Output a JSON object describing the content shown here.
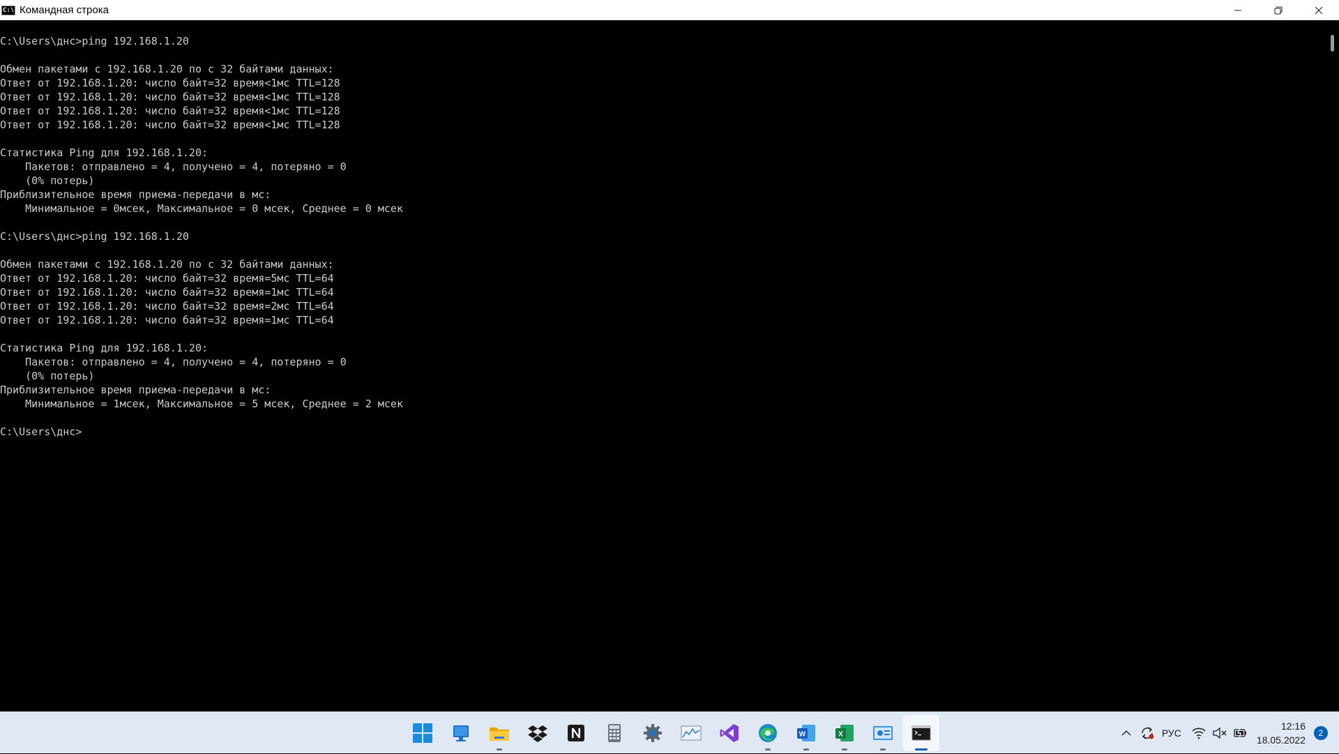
{
  "window": {
    "title": "Командная строка",
    "icon_label": "C:\\"
  },
  "console": {
    "lines": [
      "C:\\Users\\днс>ping 192.168.1.20",
      "",
      "Обмен пакетами с 192.168.1.20 по с 32 байтами данных:",
      "Ответ от 192.168.1.20: число байт=32 время<1мс TTL=128",
      "Ответ от 192.168.1.20: число байт=32 время<1мс TTL=128",
      "Ответ от 192.168.1.20: число байт=32 время<1мс TTL=128",
      "Ответ от 192.168.1.20: число байт=32 время<1мс TTL=128",
      "",
      "Статистика Ping для 192.168.1.20:",
      "    Пакетов: отправлено = 4, получено = 4, потеряно = 0",
      "    (0% потерь)",
      "Приблизительное время приема-передачи в мс:",
      "    Минимальное = 0мсек, Максимальное = 0 мсек, Среднее = 0 мсек",
      "",
      "C:\\Users\\днс>ping 192.168.1.20",
      "",
      "Обмен пакетами с 192.168.1.20 по с 32 байтами данных:",
      "Ответ от 192.168.1.20: число байт=32 время=5мс TTL=64",
      "Ответ от 192.168.1.20: число байт=32 время=1мс TTL=64",
      "Ответ от 192.168.1.20: число байт=32 время=2мс TTL=64",
      "Ответ от 192.168.1.20: число байт=32 время=1мс TTL=64",
      "",
      "Статистика Ping для 192.168.1.20:",
      "    Пакетов: отправлено = 4, получено = 4, потеряно = 0",
      "    (0% потерь)",
      "Приблизительное время приема-передачи в мс:",
      "    Минимальное = 1мсек, Максимальное = 5 мсек, Среднее = 2 мсек",
      "",
      "C:\\Users\\днс>"
    ]
  },
  "taskbar": {
    "apps": [
      {
        "name": "start-button",
        "icon": "windows-logo-icon",
        "running": false,
        "active": false
      },
      {
        "name": "taskbar-app-desktop",
        "icon": "desktop-icon",
        "running": false,
        "active": false
      },
      {
        "name": "taskbar-app-file-explorer",
        "icon": "folder-icon",
        "running": true,
        "active": false
      },
      {
        "name": "taskbar-app-dropbox",
        "icon": "dropbox-icon",
        "running": false,
        "active": false
      },
      {
        "name": "taskbar-app-notion",
        "icon": "notion-icon",
        "running": false,
        "active": false
      },
      {
        "name": "taskbar-app-calculator",
        "icon": "calculator-icon",
        "running": false,
        "active": false
      },
      {
        "name": "taskbar-app-settings",
        "icon": "gear-icon",
        "running": false,
        "active": false
      },
      {
        "name": "taskbar-app-monitor",
        "icon": "chart-icon",
        "running": false,
        "active": false
      },
      {
        "name": "taskbar-app-visual-studio",
        "icon": "visual-studio-icon",
        "running": false,
        "active": false
      },
      {
        "name": "taskbar-app-edge",
        "icon": "edge-icon",
        "running": true,
        "active": false
      },
      {
        "name": "taskbar-app-word",
        "icon": "word-icon",
        "running": true,
        "active": false
      },
      {
        "name": "taskbar-app-excel",
        "icon": "excel-icon",
        "running": true,
        "active": false
      },
      {
        "name": "taskbar-app-control-panel",
        "icon": "control-panel-icon",
        "running": true,
        "active": false
      },
      {
        "name": "taskbar-app-command-prompt",
        "icon": "terminal-icon",
        "running": true,
        "active": true
      }
    ],
    "tray": {
      "language": "РУС",
      "time": "12:16",
      "date": "18.05.2022",
      "notifications": "2"
    }
  },
  "colors": {
    "console_bg": "#000000",
    "console_fg": "#cccccc",
    "taskbar_bg": "#dfe8f3",
    "accent": "#005fb8"
  }
}
